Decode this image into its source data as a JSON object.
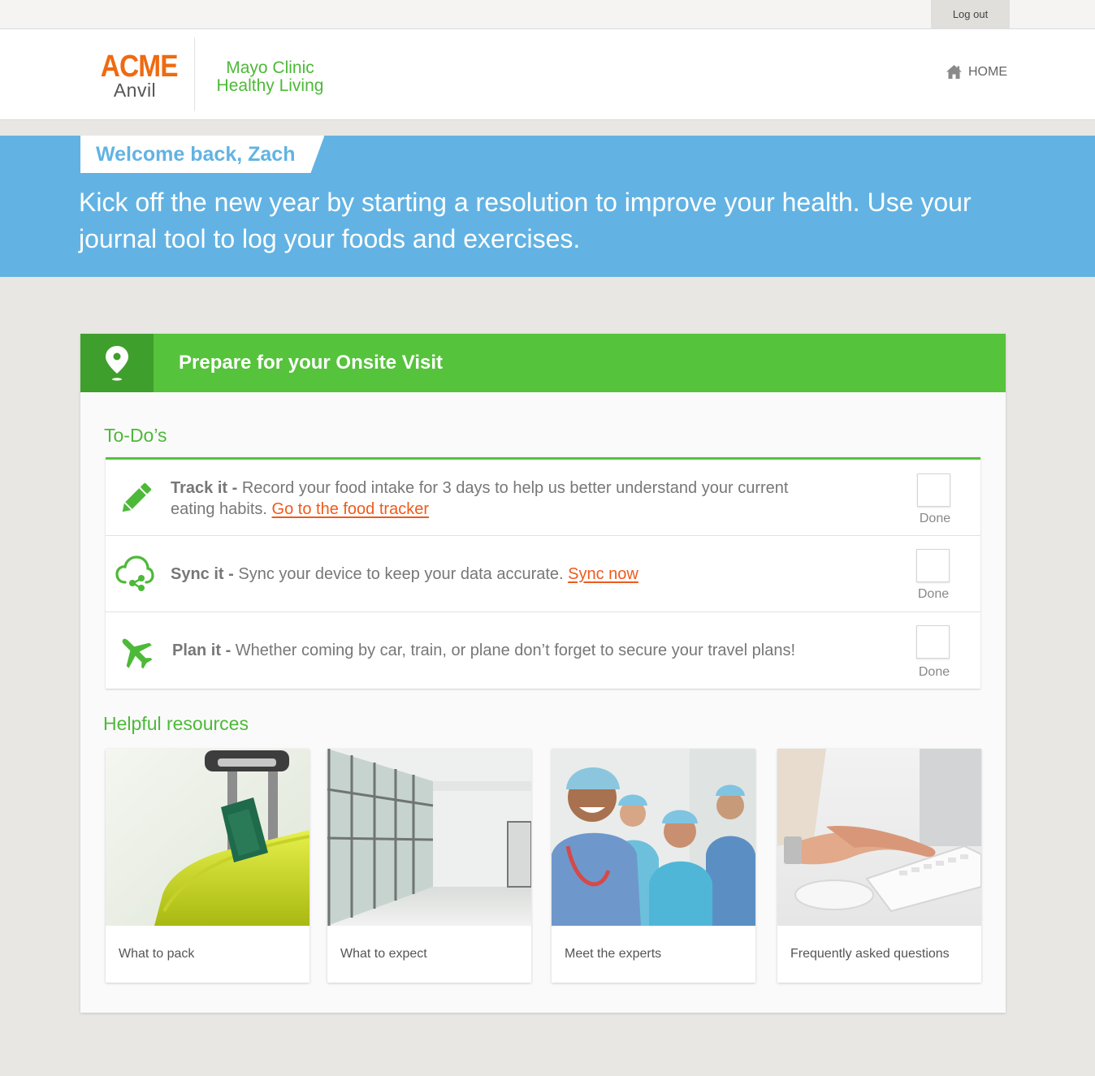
{
  "topbar": {
    "logout_label": "Log out"
  },
  "header": {
    "logo_primary": "ACME",
    "logo_secondary": "Anvil",
    "brand_line1": "Mayo Clinic",
    "brand_line2": "Healthy Living",
    "home_label": "HOME"
  },
  "banner": {
    "welcome": "Welcome back, Zach",
    "message": "Kick off the new year by starting a resolution to improve your health. Use your journal tool to log your foods and exercises."
  },
  "visit_card": {
    "title": "Prepare for your Onsite Visit",
    "todos_heading": "To-Do’s",
    "todos": [
      {
        "icon": "pencil-icon",
        "title": "Track it -",
        "text": "Record your food intake for 3 days to help us better understand your current eating habits.",
        "link": "Go to the food tracker",
        "done_label": "Done",
        "done": false
      },
      {
        "icon": "cloud-sync-icon",
        "title": "Sync it -",
        "text": "Sync your device to keep your data accurate.",
        "link": "Sync now",
        "done_label": "Done",
        "done": false
      },
      {
        "icon": "airplane-icon",
        "title": "Plan it -",
        "text": "Whether coming by car, train, or plane don’t forget to secure your travel plans!",
        "link": "",
        "done_label": "Done",
        "done": false
      }
    ],
    "resources_heading": "Helpful resources",
    "resources": [
      {
        "label": "What to pack",
        "image": "luggage-photo"
      },
      {
        "label": "What to expect",
        "image": "hallway-photo"
      },
      {
        "label": "Meet the experts",
        "image": "medical-team-photo"
      },
      {
        "label": "Frequently asked questions",
        "image": "typing-keyboard-photo"
      }
    ]
  },
  "colors": {
    "brand_orange": "#ef6a10",
    "brand_green": "#55c33b",
    "banner_blue": "#62b3e3",
    "link_orange": "#ef5a1c"
  }
}
